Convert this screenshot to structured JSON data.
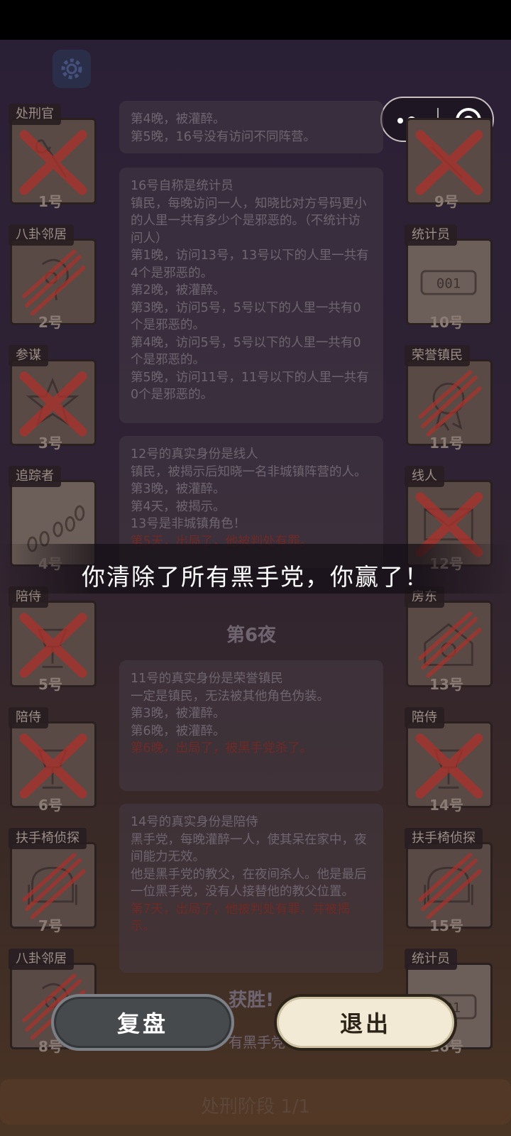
{
  "result_message": "你清除了所有黑手党，你赢了！",
  "buttons": {
    "replay": "复盘",
    "exit": "退出"
  },
  "phase_label": "处刑阶段 1/1",
  "night_heading": "第6夜",
  "victory_heading": "获胜!",
  "victory_partial": "有黑手党",
  "players_left": [
    {
      "role": "处刑官",
      "number": "1号",
      "icon": "axe-icon",
      "status": "dead-x"
    },
    {
      "role": "八卦邻居",
      "number": "2号",
      "icon": "ear-icon",
      "status": "dead-claw"
    },
    {
      "role": "参谋",
      "number": "3号",
      "icon": "star-icon",
      "status": "dead-x"
    },
    {
      "role": "追踪者",
      "number": "4号",
      "icon": "footprints-icon",
      "status": "alive"
    },
    {
      "role": "陪侍",
      "number": "5号",
      "icon": "lamp-icon",
      "status": "dead-x"
    },
    {
      "role": "陪侍",
      "number": "6号",
      "icon": "lamp-icon",
      "status": "dead-x"
    },
    {
      "role": "扶手椅侦探",
      "number": "7号",
      "icon": "armchair-icon",
      "status": "dead-claw"
    },
    {
      "role": "八卦邻居",
      "number": "8号",
      "icon": "ear-icon",
      "status": "dead-claw"
    }
  ],
  "players_right": [
    {
      "role": "",
      "number": "9号",
      "icon": "unknown-icon",
      "status": "dead-x"
    },
    {
      "role": "统计员",
      "number": "10号",
      "icon": "counter-icon",
      "status": "alive"
    },
    {
      "role": "荣誉镇民",
      "number": "11号",
      "icon": "medal-icon",
      "status": "dead-claw"
    },
    {
      "role": "线人",
      "number": "12号",
      "icon": "envelope-icon",
      "status": "dead-x"
    },
    {
      "role": "房东",
      "number": "13号",
      "icon": "house-icon",
      "status": "dead-claw"
    },
    {
      "role": "陪侍",
      "number": "14号",
      "icon": "lamp-icon",
      "status": "dead-x"
    },
    {
      "role": "扶手椅侦探",
      "number": "15号",
      "icon": "armchair-icon",
      "status": "dead-claw"
    },
    {
      "role": "统计员",
      "number": "16号",
      "icon": "counter-icon",
      "status": "alive"
    }
  ],
  "logs": [
    {
      "lines": [
        "第4晚，被灌醉。",
        "第5晚，16号没有访问不同阵营。"
      ],
      "red": []
    },
    {
      "lines": [
        "16号自称是统计员",
        "镇民，每晚访问一人，知晓比对方号码更小的人里一共有多少个是邪恶的。（不统计访问人）",
        "第1晚，访问13号，13号以下的人里一共有4个是邪恶的。",
        "第2晚，被灌醉。",
        "第3晚，访问5号，5号以下的人里一共有0个是邪恶的。",
        "第4晚，访问5号，5号以下的人里一共有0个是邪恶的。",
        "第5晚，访问11号，11号以下的人里一共有0个是邪恶的。"
      ],
      "red": []
    },
    {
      "lines": [
        "12号的真实身份是线人",
        "镇民，被揭示后知晓一名非城镇阵营的人。",
        "第3晚，被灌醉。",
        "第4天，被揭示。",
        "13号是非城镇角色！"
      ],
      "red": [
        "第5天，出局了，他被判处有罪。"
      ]
    },
    {
      "lines": [
        "11号的真实身份是荣誉镇民",
        "一定是镇民，无法被其他角色伪装。",
        "第3晚，被灌醉。",
        "第6晚，被灌醉。"
      ],
      "red": [
        "第6晚，出局了，被黑手党杀了。"
      ]
    },
    {
      "lines": [
        "14号的真实身份是陪侍",
        "黑手党，每晚灌醉一人，使其呆在家中，夜间能力无效。",
        "他是黑手党的教父，在夜间杀人。他是最后一位黑手党，没有人接替他的教父位置。"
      ],
      "red": [
        "第7天，出局了，他被判处有罪，并被揭示。"
      ]
    }
  ],
  "colors": {
    "accent_exit": "#f3ead5",
    "replay": "#474a4c",
    "x_mark": "#c0302c"
  }
}
